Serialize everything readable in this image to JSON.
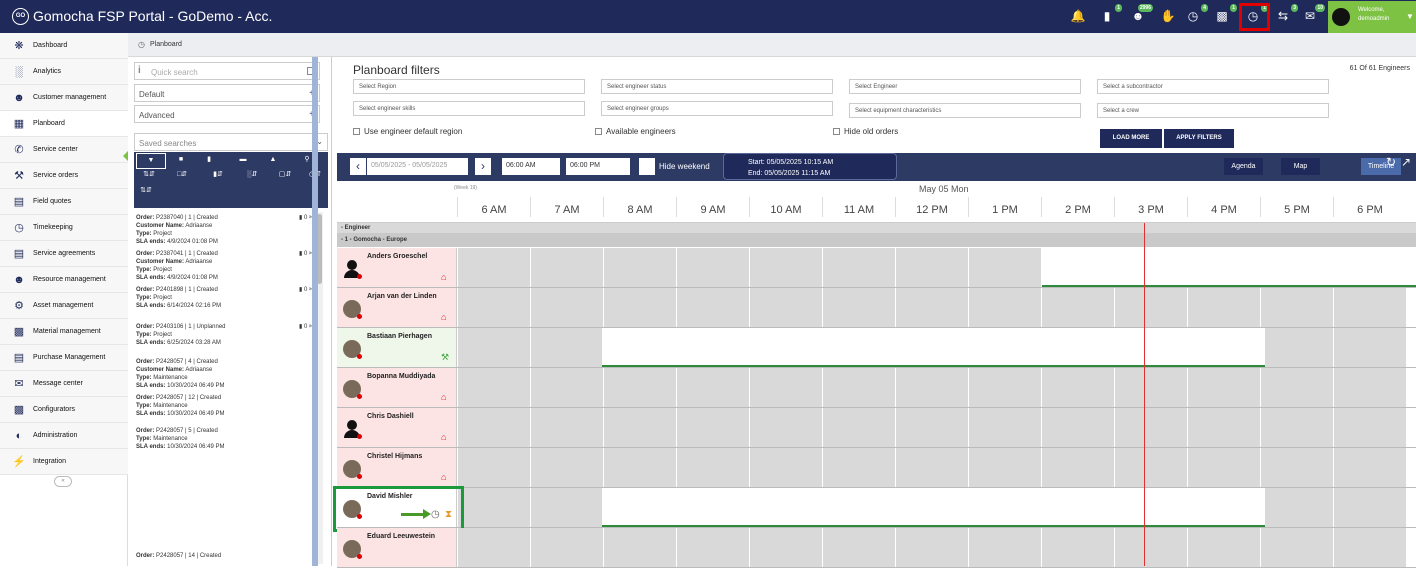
{
  "app": {
    "title": "Gomocha FSP Portal - GoDemo - Acc.",
    "logo_text": "GO",
    "user": {
      "welcome": "Welcome,",
      "name": "demoadmin"
    }
  },
  "top_icons": [
    {
      "name": "bell-icon",
      "badge": ""
    },
    {
      "name": "document-icon",
      "badge": "1"
    },
    {
      "name": "people-icon",
      "badge": "2996"
    },
    {
      "name": "handshake-icon",
      "badge": ""
    },
    {
      "name": "clock-check-icon",
      "badge": "4"
    },
    {
      "name": "stats-icon",
      "badge": "1"
    },
    {
      "name": "timer-icon",
      "badge": "1"
    },
    {
      "name": "transfer-icon",
      "badge": "3"
    },
    {
      "name": "chat-icon",
      "badge": "10"
    }
  ],
  "sidebar": {
    "items": [
      {
        "label": "Dashboard",
        "icon": "palette-icon"
      },
      {
        "label": "Analytics",
        "icon": "bar-chart-icon"
      },
      {
        "label": "Customer management",
        "icon": "users-icon"
      },
      {
        "label": "Planboard",
        "icon": "calendar-icon"
      },
      {
        "label": "Service center",
        "icon": "phone-icon"
      },
      {
        "label": "Service orders",
        "icon": "tools-icon"
      },
      {
        "label": "Field quotes",
        "icon": "clipboard-icon"
      },
      {
        "label": "Timekeeping",
        "icon": "clock-icon"
      },
      {
        "label": "Service agreements",
        "icon": "contract-icon"
      },
      {
        "label": "Resource management",
        "icon": "group-icon"
      },
      {
        "label": "Asset management",
        "icon": "gears-icon"
      },
      {
        "label": "Material management",
        "icon": "boxes-icon"
      },
      {
        "label": "Purchase Management",
        "icon": "store-icon"
      },
      {
        "label": "Message center",
        "icon": "envelope-icon"
      },
      {
        "label": "Configurators",
        "icon": "factory-icon"
      },
      {
        "label": "Administration",
        "icon": "shield-icon"
      },
      {
        "label": "Integration",
        "icon": "plug-icon"
      }
    ],
    "collapse_label": "«"
  },
  "breadcrumb": {
    "label": "Planboard"
  },
  "left_panel": {
    "quick_search_placeholder": "Quick search",
    "default_label": "Default",
    "advanced_label": "Advanced",
    "saved_searches": "Saved searches",
    "orders": [
      {
        "order": "P2387040 | 1 | Created",
        "customer": "Adriaanse",
        "type": "Project",
        "sla": "4/9/2024 01:08 PM",
        "count": "0"
      },
      {
        "order": "P2387041 | 1 | Created",
        "customer": "Adriaanse",
        "type": "Project",
        "sla": "4/9/2024 01:08 PM",
        "count": "0"
      },
      {
        "order": "P2401898 | 1 | Created",
        "customer": "",
        "type": "Project",
        "sla": "6/14/2024 02:16 PM",
        "count": "0"
      },
      {
        "order": "P2403106 | 1 | Unplanned",
        "customer": "",
        "type": "Project",
        "sla": "6/25/2024 03:28 AM",
        "count": "0"
      },
      {
        "order": "P2428057 | 4 | Created",
        "customer": "Adriaanse",
        "type": "Maintenance",
        "sla": "10/30/2024 06:49 PM",
        "count": ""
      },
      {
        "order": "P2428057 | 12 | Created",
        "customer": "",
        "type": "Maintenance",
        "sla": "10/30/2024 06:49 PM",
        "count": ""
      },
      {
        "order": "P2428057 | 5 | Created",
        "customer": "",
        "type": "Maintenance",
        "sla": "10/30/2024 06:49 PM",
        "count": ""
      },
      {
        "order": "P2428057 | 14 | Created",
        "customer": "",
        "type": "",
        "sla": "",
        "count": ""
      }
    ],
    "labels": {
      "order": "Order:",
      "customer": "Customer Name:",
      "type": "Type:",
      "sla": "SLA ends:"
    }
  },
  "filters": {
    "title": "Planboard filters",
    "count": "61 Of 61 Engineers",
    "selects": [
      "Select Region",
      "Select engineer status",
      "Select Engineer",
      "Select a subcontractor",
      "Select engineer skills",
      "Select engineer groups",
      "Select equipment characteristics",
      "Select a crew"
    ],
    "checkboxes": [
      "Use engineer default region",
      "Available engineers",
      "Hide old orders"
    ],
    "load_more": "LOAD MORE",
    "apply": "APPLY FILTERS"
  },
  "timeline_bar": {
    "date_range": "05/05/2025 - 05/05/2025",
    "start_time": "06:00 AM",
    "end_time": "06:00 PM",
    "hide_weekend": "Hide weekend",
    "start": "Start: 05/05/2025 10:15 AM",
    "end": "End: 05/05/2025 11:15 AM",
    "views": [
      "Agenda",
      "Map",
      "Timeline"
    ]
  },
  "schedule": {
    "week": "(Week 19)",
    "date": "May 05 Mon",
    "hours": [
      "6 AM",
      "7 AM",
      "8 AM",
      "9 AM",
      "10 AM",
      "11 AM",
      "12 PM",
      "1 PM",
      "2 PM",
      "3 PM",
      "4 PM",
      "5 PM",
      "6 PM"
    ],
    "group1": "- Engineer",
    "group2": "- 1 - Gomocha - Europe",
    "engineers": [
      {
        "name": "Anders Groeschel"
      },
      {
        "name": "Arjan van der Linden"
      },
      {
        "name": "Bastiaan Pierhagen"
      },
      {
        "name": "Bopanna Muddiyada"
      },
      {
        "name": "Chris Dashiell"
      },
      {
        "name": "Christel Hijmans"
      },
      {
        "name": "David Mishler"
      },
      {
        "name": "Eduard Leeuwestein"
      }
    ]
  }
}
